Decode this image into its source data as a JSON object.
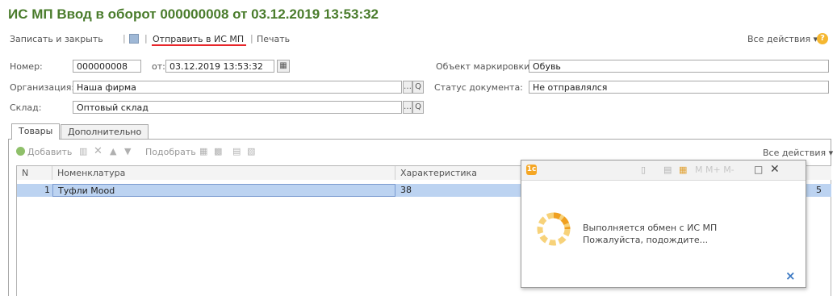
{
  "window": {
    "title": "ИС МП Ввод в оборот 000000008 от 03.12.2019 13:53:32"
  },
  "toolbar": {
    "save_close": "Записать и закрыть",
    "send": "Отправить в ИС МП",
    "print": "Печать",
    "all_actions": "Все действия ▾",
    "help": "?"
  },
  "form": {
    "number_label": "Номер:",
    "number_value": "000000008",
    "date_label": "от:",
    "date_value": "03.12.2019 13:53:32",
    "org_label": "Организация:",
    "org_value": "Наша фирма",
    "warehouse_label": "Склад:",
    "warehouse_value": "Оптовый склад",
    "object_label": "Объект маркировки:",
    "object_value": "Обувь",
    "status_label": "Статус документа:",
    "status_value": "Не отправлялся"
  },
  "tabs": [
    "Товары",
    "Дополнительно"
  ],
  "goods_toolbar": {
    "add": "Добавить",
    "pick": "Подобрать",
    "all_actions": "Все действия ▾"
  },
  "table": {
    "headers": [
      "N",
      "Номенклатура",
      "Характеристика"
    ],
    "rows": [
      {
        "n": "1",
        "item": "Туфли Mood",
        "char": "38",
        "tail": "5"
      }
    ]
  },
  "dialog": {
    "toolbar_text": "M  M+  M-",
    "message_line1": "Выполняется обмен с ИС МП",
    "message_line2": "Пожалуйста, подождите...",
    "cancel_icon": "×"
  },
  "colors": {
    "title": "#4a7c2c",
    "underline": "#e8262b",
    "selection": "#bcd3f1",
    "spinner": "#f5b731"
  }
}
